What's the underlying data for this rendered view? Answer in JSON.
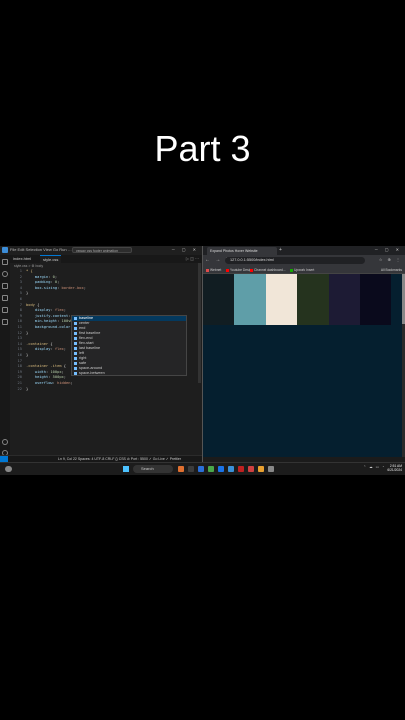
{
  "overlay_title": "Part 3",
  "vscode": {
    "command_center": "ysway css footer animation",
    "menu": "File Edit Selection View Go Run …",
    "tabs": [
      {
        "label": "index.html"
      },
      {
        "label": "style.css"
      }
    ],
    "breadcrumb": "style.css > ⚙ body",
    "code_lines": [
      {
        "n": "1",
        "segs": [
          {
            "t": "* {",
            "c": "sel"
          }
        ]
      },
      {
        "n": "2",
        "segs": [
          {
            "t": "    margin",
            "c": "prop"
          },
          {
            "t": ": ",
            "c": "punc"
          },
          {
            "t": "0",
            "c": "num"
          },
          {
            "t": ";",
            "c": "punc"
          }
        ]
      },
      {
        "n": "3",
        "segs": [
          {
            "t": "    padding",
            "c": "prop"
          },
          {
            "t": ": ",
            "c": "punc"
          },
          {
            "t": "0",
            "c": "num"
          },
          {
            "t": ";",
            "c": "punc"
          }
        ]
      },
      {
        "n": "4",
        "segs": [
          {
            "t": "    box-sizing",
            "c": "prop"
          },
          {
            "t": ": ",
            "c": "punc"
          },
          {
            "t": "border-box",
            "c": "val"
          },
          {
            "t": ";",
            "c": "punc"
          }
        ]
      },
      {
        "n": "5",
        "segs": [
          {
            "t": "}",
            "c": "punc"
          }
        ]
      },
      {
        "n": "6",
        "segs": []
      },
      {
        "n": "7",
        "segs": [
          {
            "t": "body",
            "c": "sel"
          },
          {
            "t": " {",
            "c": "punc"
          }
        ]
      },
      {
        "n": "8",
        "segs": [
          {
            "t": "    display",
            "c": "prop"
          },
          {
            "t": ": ",
            "c": "punc"
          },
          {
            "t": "flex",
            "c": "val"
          },
          {
            "t": ";",
            "c": "punc"
          }
        ]
      },
      {
        "n": "9",
        "segs": [
          {
            "t": "    justify-content",
            "c": "prop"
          },
          {
            "t": ": ",
            "c": "punc"
          },
          {
            "t": ";",
            "c": "punc"
          }
        ]
      },
      {
        "n": "10",
        "segs": [
          {
            "t": "    min-height",
            "c": "prop"
          },
          {
            "t": ": ",
            "c": "punc"
          },
          {
            "t": "100vh",
            "c": "num"
          },
          {
            "t": ";",
            "c": "punc"
          }
        ]
      },
      {
        "n": "11",
        "segs": [
          {
            "t": "    background-color",
            "c": "prop"
          },
          {
            "t": ": ",
            "c": "punc"
          }
        ]
      },
      {
        "n": "12",
        "segs": [
          {
            "t": "}",
            "c": "punc"
          }
        ]
      },
      {
        "n": "13",
        "segs": []
      },
      {
        "n": "14",
        "segs": [
          {
            "t": ".container",
            "c": "sel"
          },
          {
            "t": " {",
            "c": "punc"
          }
        ]
      },
      {
        "n": "15",
        "segs": [
          {
            "t": "    display",
            "c": "prop"
          },
          {
            "t": ": ",
            "c": "punc"
          },
          {
            "t": "flex",
            "c": "val"
          },
          {
            "t": ";",
            "c": "punc"
          }
        ]
      },
      {
        "n": "16",
        "segs": [
          {
            "t": "}",
            "c": "punc"
          }
        ]
      },
      {
        "n": "17",
        "segs": []
      },
      {
        "n": "18",
        "segs": [
          {
            "t": ".container .item",
            "c": "sel"
          },
          {
            "t": " {",
            "c": "punc"
          }
        ]
      },
      {
        "n": "19",
        "segs": [
          {
            "t": "    width",
            "c": "prop"
          },
          {
            "t": ": ",
            "c": "punc"
          },
          {
            "t": "100px",
            "c": "num"
          },
          {
            "t": ";",
            "c": "punc"
          }
        ]
      },
      {
        "n": "20",
        "segs": [
          {
            "t": "    height",
            "c": "prop"
          },
          {
            "t": ": ",
            "c": "punc"
          },
          {
            "t": "500px",
            "c": "num"
          },
          {
            "t": ";",
            "c": "punc"
          }
        ]
      },
      {
        "n": "21",
        "segs": [
          {
            "t": "    overflow",
            "c": "prop"
          },
          {
            "t": ": ",
            "c": "punc"
          },
          {
            "t": "hidden",
            "c": "val"
          },
          {
            "t": ";",
            "c": "punc"
          }
        ]
      },
      {
        "n": "22",
        "segs": [
          {
            "t": "}",
            "c": "punc"
          }
        ]
      }
    ],
    "suggestions": [
      {
        "label": "baseline",
        "selected": true
      },
      {
        "label": "center"
      },
      {
        "label": "end"
      },
      {
        "label": "first baseline"
      },
      {
        "label": "flex-end"
      },
      {
        "label": "flex-start"
      },
      {
        "label": "last baseline"
      },
      {
        "label": "left"
      },
      {
        "label": "right"
      },
      {
        "label": "safe"
      },
      {
        "label": "space-around"
      },
      {
        "label": "space-between"
      }
    ],
    "status": "Ln 9, Col 22   Spaces: 4   UTF-8   CRLF   {} CSS   ⊘ Port : 5500   ✓ Go Live   ✓ Prettier"
  },
  "browser": {
    "tab_title": "Expand Photos Hover Website",
    "url": "127.0.0.1:5500/index.html",
    "bookmarks": [
      {
        "label": "Webnet",
        "color": "#e04b4b"
      },
      {
        "label": "Youtube Design",
        "color": "#ff0000"
      },
      {
        "label": "Channel dashboard...",
        "color": "#ff0000"
      },
      {
        "label": "Upwork Insert",
        "color": "#14a800"
      }
    ],
    "all_bookmarks": "All Bookmarks",
    "panel_colors": [
      "#111d22",
      "#5f9ea8",
      "#f1e6d8",
      "#25331e",
      "#1d1b34",
      "#0a0a1c"
    ]
  },
  "taskbar": {
    "search": "Search",
    "app_colors": [
      "#e07030",
      "#3c3c3c",
      "#2a6fd8",
      "#4aa84a",
      "#1a73e8",
      "#3a90d8",
      "#c02020",
      "#d04040",
      "#e8a030",
      "#888888"
    ],
    "tray": "⌃ ☁ ▭ ◔",
    "time": "2:51 AM",
    "date": "6/21/2024"
  }
}
